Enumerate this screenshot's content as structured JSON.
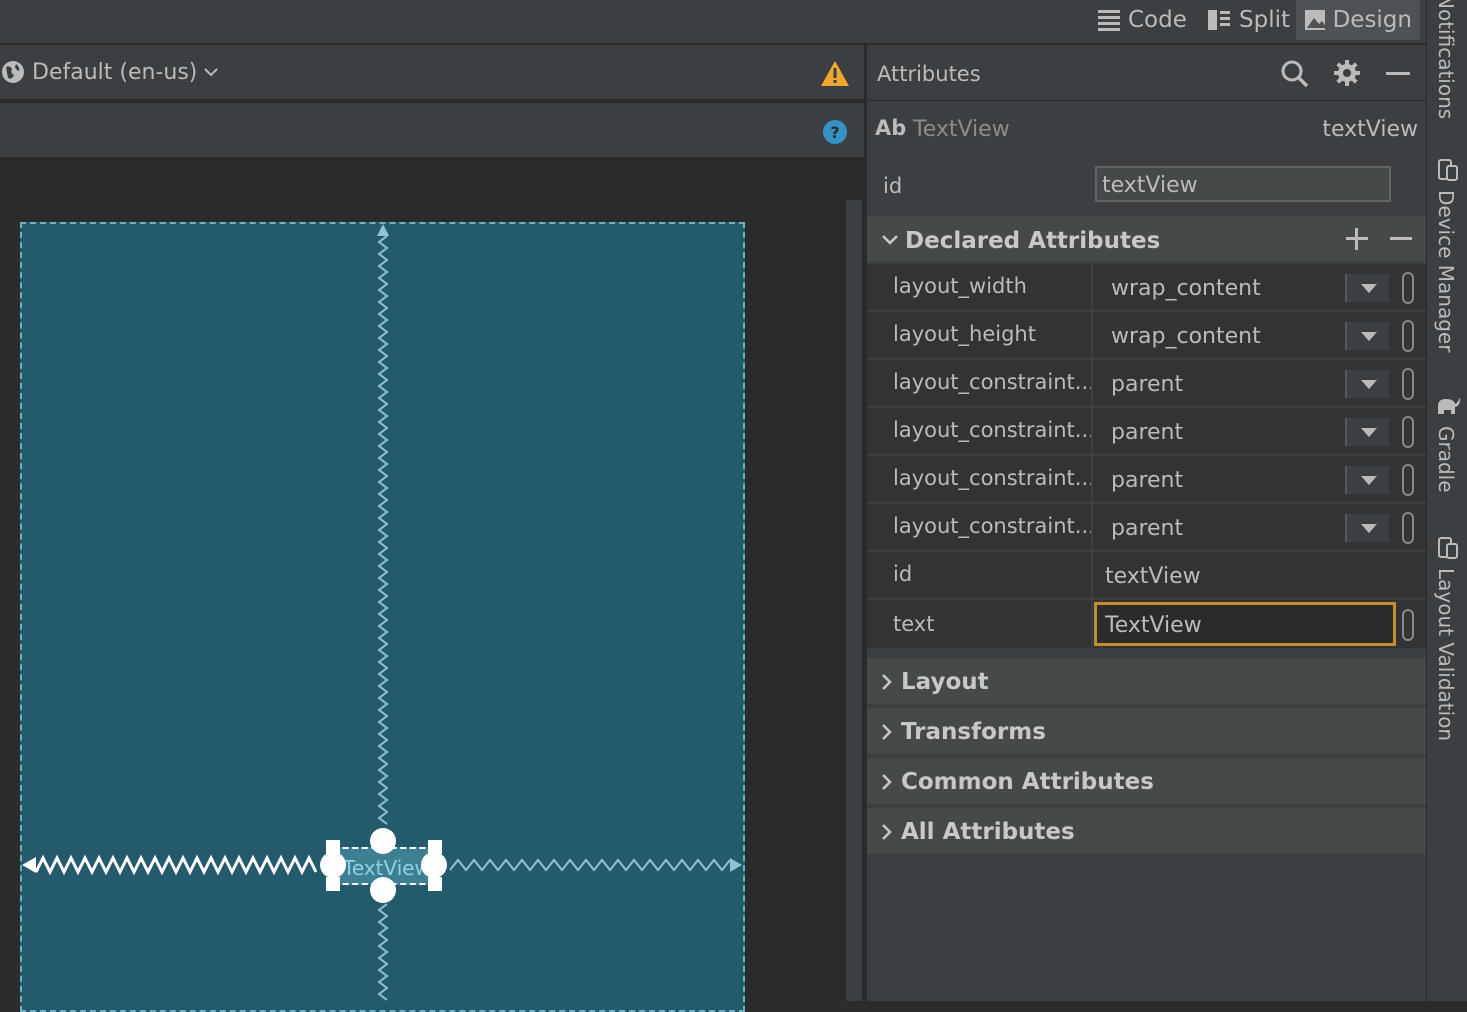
{
  "toolbar": {
    "code_label": "Code",
    "split_label": "Split",
    "design_label": "Design"
  },
  "editor": {
    "locale_label": "Default (en-us)",
    "widget_label": "TextView"
  },
  "attributes": {
    "title": "Attributes",
    "component_prefix": "Ab",
    "component_type": "TextView",
    "component_id": "textView",
    "id_label": "id",
    "id_value": "textView",
    "declared_title": "Declared Attributes",
    "declared": [
      {
        "name": "layout_width",
        "value": "wrap_content"
      },
      {
        "name": "layout_height",
        "value": "wrap_content"
      },
      {
        "name": "layout_constraint...",
        "value": "parent"
      },
      {
        "name": "layout_constraint...",
        "value": "parent"
      },
      {
        "name": "layout_constraint...",
        "value": "parent"
      },
      {
        "name": "layout_constraint...",
        "value": "parent"
      },
      {
        "name": "id",
        "value": "textView"
      },
      {
        "name": "text",
        "value": "TextView"
      }
    ],
    "sections": [
      "Layout",
      "Transforms",
      "Common Attributes",
      "All Attributes"
    ]
  },
  "side_tabs": [
    "Notifications",
    "Device Manager",
    "Gradle",
    "Layout Validation"
  ],
  "colors": {
    "accent_focus": "#c08f2e",
    "warning": "#f0a732",
    "help": "#3592c4",
    "device_bg": "#235b6d"
  }
}
